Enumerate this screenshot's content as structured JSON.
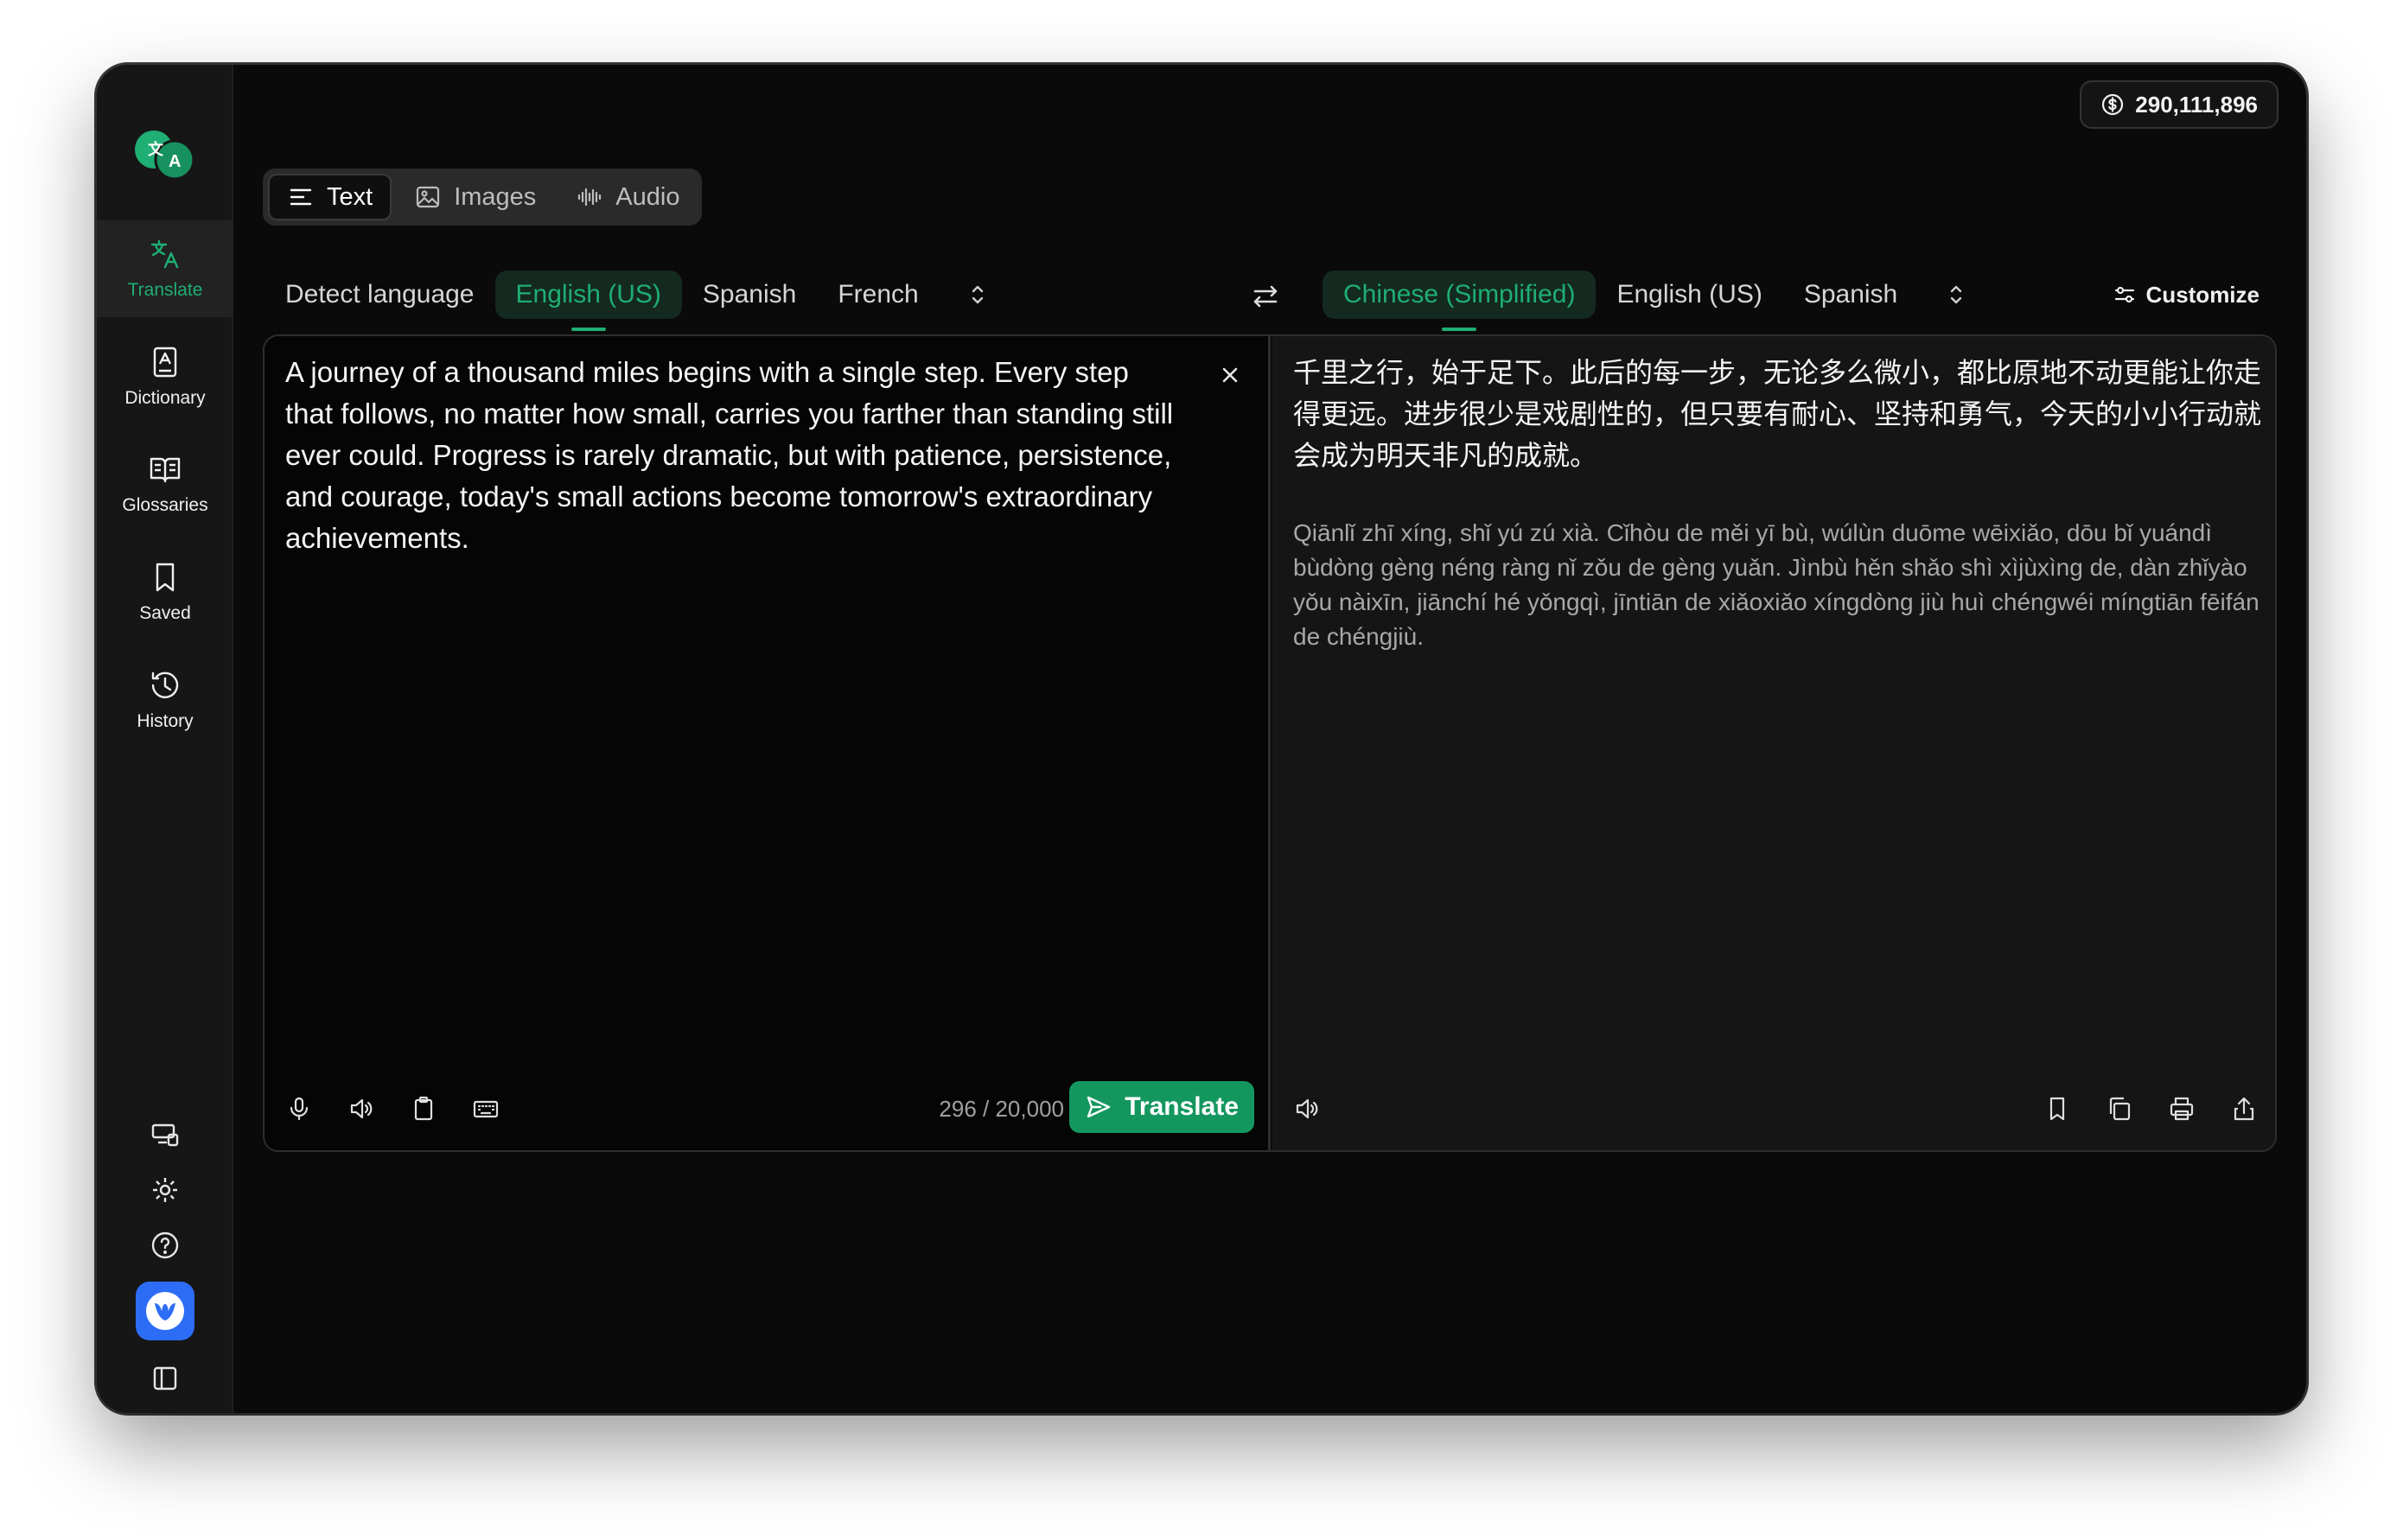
{
  "credits": {
    "icon": "dollar-circle-icon",
    "value": "290,111,896"
  },
  "sidebar": {
    "items": [
      {
        "label": "Translate",
        "icon": "translate-icon",
        "active": true
      },
      {
        "label": "Dictionary",
        "icon": "dictionary-icon"
      },
      {
        "label": "Glossaries",
        "icon": "book-open-icon"
      },
      {
        "label": "Saved",
        "icon": "bookmark-icon"
      },
      {
        "label": "History",
        "icon": "history-icon"
      }
    ],
    "bottom_icons": [
      "devices-icon",
      "gear-icon",
      "help-icon",
      "app-avatar-icon",
      "sidebar-toggle-icon"
    ]
  },
  "mode_tabs": [
    {
      "label": "Text",
      "icon": "text-lines-icon",
      "active": true
    },
    {
      "label": "Images",
      "icon": "image-icon"
    },
    {
      "label": "Audio",
      "icon": "waveform-icon"
    }
  ],
  "source_langs": {
    "options": [
      "Detect language",
      "English (US)",
      "Spanish",
      "French"
    ],
    "active": "English (US)"
  },
  "target_langs": {
    "options": [
      "Chinese (Simplified)",
      "English (US)",
      "Spanish"
    ],
    "active": "Chinese (Simplified)"
  },
  "customize_label": "Customize",
  "source": {
    "text": "A journey of a thousand miles begins with a single step. Every step that follows, no matter how small, carries you farther than standing still ever could. Progress is rarely dramatic, but with patience, persistence, and courage, today's small actions become tomorrow's extraordinary achievements.",
    "char_count": "296 / 20,000",
    "translate_label": "Translate"
  },
  "target": {
    "text": "千里之行，始于足下。此后的每一步，无论多么微小，都比原地不动更能让你走得更远。进步很少是戏剧性的，但只要有耐心、坚持和勇气，今天的小小行动就会成为明天非凡的成就。",
    "pinyin": "Qiānlǐ zhī xíng, shǐ yú zú xià. Cǐhòu de měi yī bù, wúlùn duōme wēixiǎo, dōu bǐ yuándì bùdòng gèng néng ràng nǐ zǒu de gèng yuǎn. Jìnbù hěn shǎo shì xìjùxìng de, dàn zhǐyào yǒu nàixīn, jiānchí hé yǒngqì, jīntiān de xiǎoxiǎo xíngdòng jiù huì chéngwéi míngtiān fēifán de chéngjiù."
  },
  "colors": {
    "accent": "#1fae74",
    "button": "#14975f",
    "background": "#0a0a0a"
  }
}
